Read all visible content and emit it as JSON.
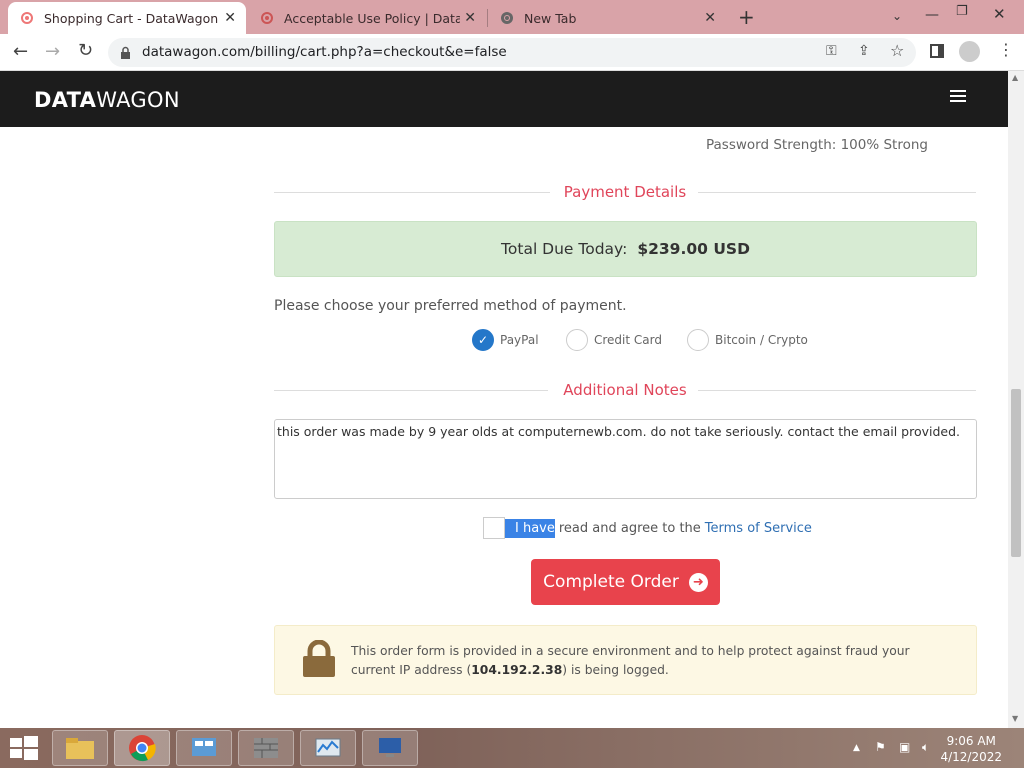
{
  "browser": {
    "tabs": [
      {
        "label": "Shopping Cart - DataWagon",
        "active": true
      },
      {
        "label": "Acceptable Use Policy | DataWag",
        "active": false
      },
      {
        "label": "New Tab",
        "active": false
      }
    ],
    "url": "datawagon.com/billing/cart.php?a=checkout&e=false"
  },
  "site": {
    "logo_bold": "DATA",
    "logo_light": "WAGON"
  },
  "checkout": {
    "password_strength": "Password Strength: 100% Strong",
    "payment_section_title": "Payment Details",
    "total_label": "Total Due Today:",
    "total_value": "$239.00 USD",
    "payment_prompt": "Please choose your preferred method of payment.",
    "payment_methods": [
      {
        "label": "PayPal",
        "selected": true
      },
      {
        "label": "Credit Card",
        "selected": false
      },
      {
        "label": "Bitcoin / Crypto",
        "selected": false
      }
    ],
    "notes_section_title": "Additional Notes",
    "notes_value": "this order was made by 9 year olds at computernewb.com. do not take seriously. contact the email provided.",
    "tos_selected_text": "I have",
    "tos_text": "read and agree to the",
    "tos_link": "Terms of Service",
    "complete_button": "Complete Order",
    "secure_text_1": "This order form is provided in a secure environment and to help protect against fraud your current IP address (",
    "ip_address": "104.192.2.38",
    "secure_text_2": ") is being logged."
  },
  "taskbar": {
    "time": "9:06 AM",
    "date": "4/12/2022"
  },
  "colors": {
    "accent_red": "#e8434c",
    "section_title": "#e0455a",
    "navbar": "#1c1c1c",
    "total_bg": "#d7ebd3",
    "radio_selected": "#2477c9"
  }
}
